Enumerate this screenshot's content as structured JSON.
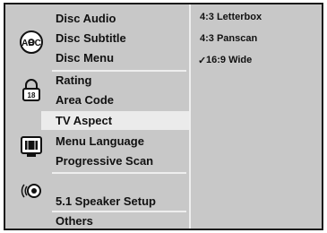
{
  "menu": {
    "groups": [
      {
        "icon": "disc-abc-icon",
        "items": [
          "Disc Audio",
          "Disc Subtitle",
          "Disc Menu"
        ]
      },
      {
        "icon": "lock-rating-icon",
        "items": [
          "Rating",
          "Area Code"
        ]
      },
      {
        "icon": "tv-aspect-icon",
        "items": [
          "TV Aspect",
          "Menu Language",
          "Progressive Scan"
        ]
      },
      {
        "icon": "speaker-icon",
        "items": [
          "5.1 Speaker Setup"
        ]
      },
      {
        "icon": "",
        "items": [
          "Others"
        ]
      }
    ],
    "selected": "TV Aspect"
  },
  "options": {
    "items": [
      "4:3 Letterbox",
      "4:3 Panscan",
      "16:9 Wide"
    ],
    "checked": "16:9 Wide",
    "check_mark": "✓"
  },
  "colors": {
    "panel": "#c8c8c8",
    "highlight": "#ebebeb",
    "separator": "#eeeeee",
    "border": "#1a1a1a"
  }
}
